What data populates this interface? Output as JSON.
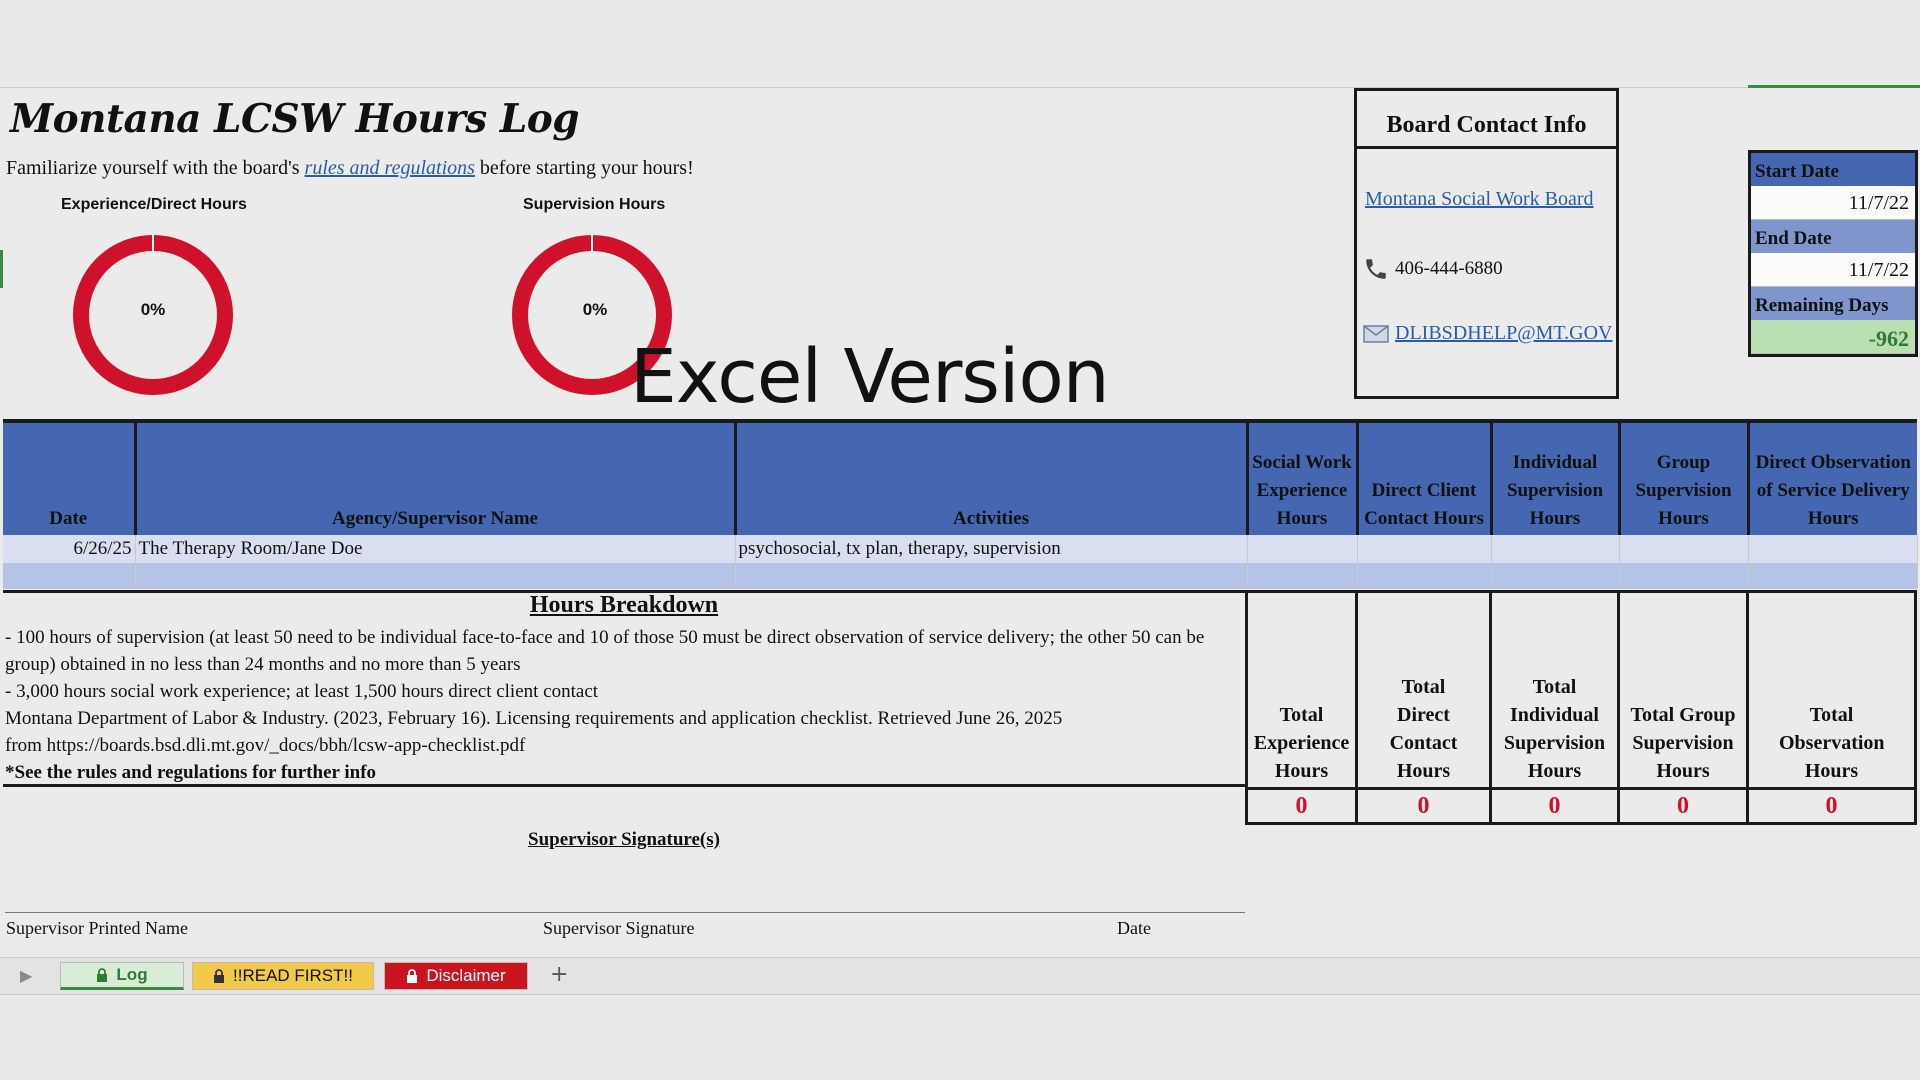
{
  "title": "Montana LCSW Hours Log",
  "intro": {
    "before": "Familiarize yourself with the board's ",
    "link": "rules and regulations",
    "after": " before starting your hours!"
  },
  "charts": {
    "experience": {
      "label": "Experience/Direct Hours",
      "percent_text": "0%",
      "percent": 0
    },
    "supervision": {
      "label": "Supervision Hours",
      "percent_text": "0%",
      "percent": 0
    }
  },
  "watermark": "Excel Version",
  "board": {
    "heading": "Board Contact Info",
    "link": "Montana Social Work Board",
    "phone": "406-444-6880",
    "email": "DLIBSDHELP@MT.GOV",
    "icons": {
      "phone": "phone-icon",
      "email": "email-icon"
    }
  },
  "dates": {
    "start_label": "Start Date",
    "start_value": "11/7/22",
    "end_label": "End Date",
    "end_value": "11/7/22",
    "remaining_label": "Remaining Days",
    "remaining_value": "-962"
  },
  "table": {
    "headers": [
      "Date",
      "Agency/Supervisor Name",
      "Activities",
      "Social Work Experience Hours",
      "Direct Client Contact Hours",
      "Individual Supervision Hours",
      "Group Supervision Hours",
      "Direct Observation of Service Delivery Hours"
    ],
    "rows": [
      [
        "6/26/25",
        "The Therapy Room/Jane Doe",
        "psychosocial, tx plan, therapy, supervision",
        "",
        "",
        "",
        "",
        ""
      ],
      [
        "",
        "",
        "",
        "",
        "",
        "",
        "",
        ""
      ]
    ]
  },
  "breakdown": {
    "title": "Hours Breakdown",
    "lines": [
      "- 100 hours of supervision (at least 50 need to be individual face-to-face and 10 of those 50 must be direct observation of service delivery; the other 50 can be group) obtained in no less than 24 months and no more than 5 years",
      "- 3,000 hours social work experience; at least 1,500 hours direct client contact",
      "Montana Department of Labor & Industry. (2023, February 16). Licensing requirements and application checklist. Retrieved June 26, 2025 from https://boards.bsd.dli.mt.gov/_docs/bbh/lcsw-app-checklist.pdf"
    ],
    "note": "*See the rules and regulations for further info"
  },
  "totals": [
    {
      "label": "Total Experience Hours",
      "value": "0"
    },
    {
      "label": "Total Direct Contact Hours",
      "value": "0"
    },
    {
      "label": "Total Individual Supervision Hours",
      "value": "0"
    },
    {
      "label": "Total Group Supervision Hours",
      "value": "0"
    },
    {
      "label": "Total Observation Hours",
      "value": "0"
    }
  ],
  "signature": {
    "title": "Supervisor Signature(s)",
    "printed_name": "Supervisor Printed Name",
    "signature": "Supervisor Signature",
    "date": "Date"
  },
  "tabs": {
    "log": "Log",
    "read_first": "!!READ FIRST!!",
    "disclaimer": "Disclaimer",
    "add": "+"
  },
  "colors": {
    "header_blue": "#4566b0",
    "donut_red": "#d0112b",
    "total_red": "#d0112b",
    "remaining_green": "#b9dfb3"
  }
}
